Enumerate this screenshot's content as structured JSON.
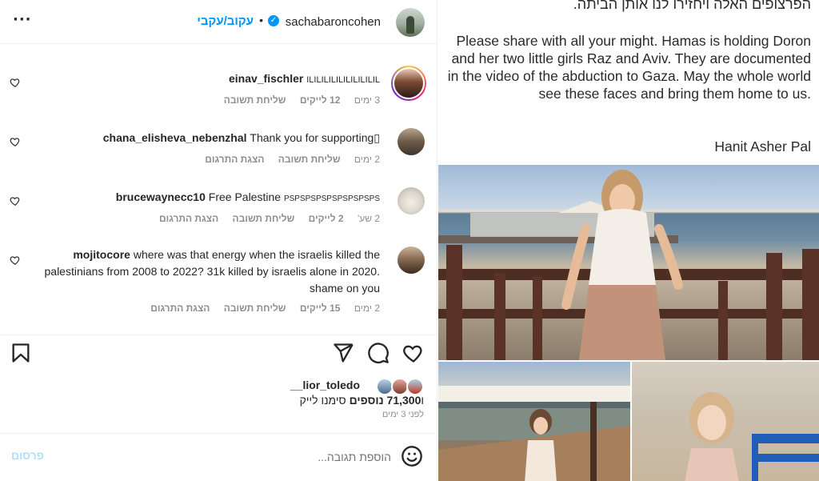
{
  "header": {
    "username": "sachabaroncohen",
    "separator": "•",
    "follow_label": "עקוב/עקבי",
    "more_label": "···"
  },
  "comments": [
    {
      "username": "einav_fischler",
      "text": "ILILILILILILILILILIL",
      "time": "3 ימים",
      "likes": "12 לייקים",
      "reply": "שליחת תשובה",
      "translate": ""
    },
    {
      "username": "chana_elisheva_nebenzhal",
      "text": "Thank you for supporting▯",
      "time": "2 ימים",
      "likes": "",
      "reply": "שליחת תשובה",
      "translate": "הצגת התרגום"
    },
    {
      "username": "brucewaynecc10",
      "text": "Free Palestine PSPSPSPSPSPSPSPSPS",
      "time": "2 שע'",
      "likes": "2 לייקים",
      "reply": "שליחת תשובה",
      "translate": "הצגת התרגום"
    },
    {
      "username": "mojitocore",
      "text": "where was that energy when the israelis killed the palestinians from 2008 to 2022? 31k killed by israelis alone in 2020. shame on you",
      "time": "2 ימים",
      "likes": "15 לייקים",
      "reply": "שליחת תשובה",
      "translate": "הצגת התרגום"
    }
  ],
  "likes": {
    "liked_by": "lior_toledo__",
    "count": "71,300",
    "count_prefix": "ו",
    "more_label": "נוספים",
    "suffix": "סימנו לייק",
    "time_ago": "לפני 3 ימים"
  },
  "comment_bar": {
    "placeholder": "הוספת תגובה...",
    "post_label": "פרסום"
  },
  "post": {
    "hebrew_line": "הפרצופים האלה ויחזירו לנו אותן הביתה.",
    "english_text": "Please share with all your might. Hamas is holding Doron and her two little girls Raz and Aviv. They are documented in the video of the abduction to Gaza. May the whole world see these faces and bring them home to us.",
    "signature": "Hanit Asher Pal"
  },
  "colors": {
    "link_blue": "#0095f6",
    "muted": "#8e8e8e",
    "post_disabled": "#b2dffc"
  }
}
